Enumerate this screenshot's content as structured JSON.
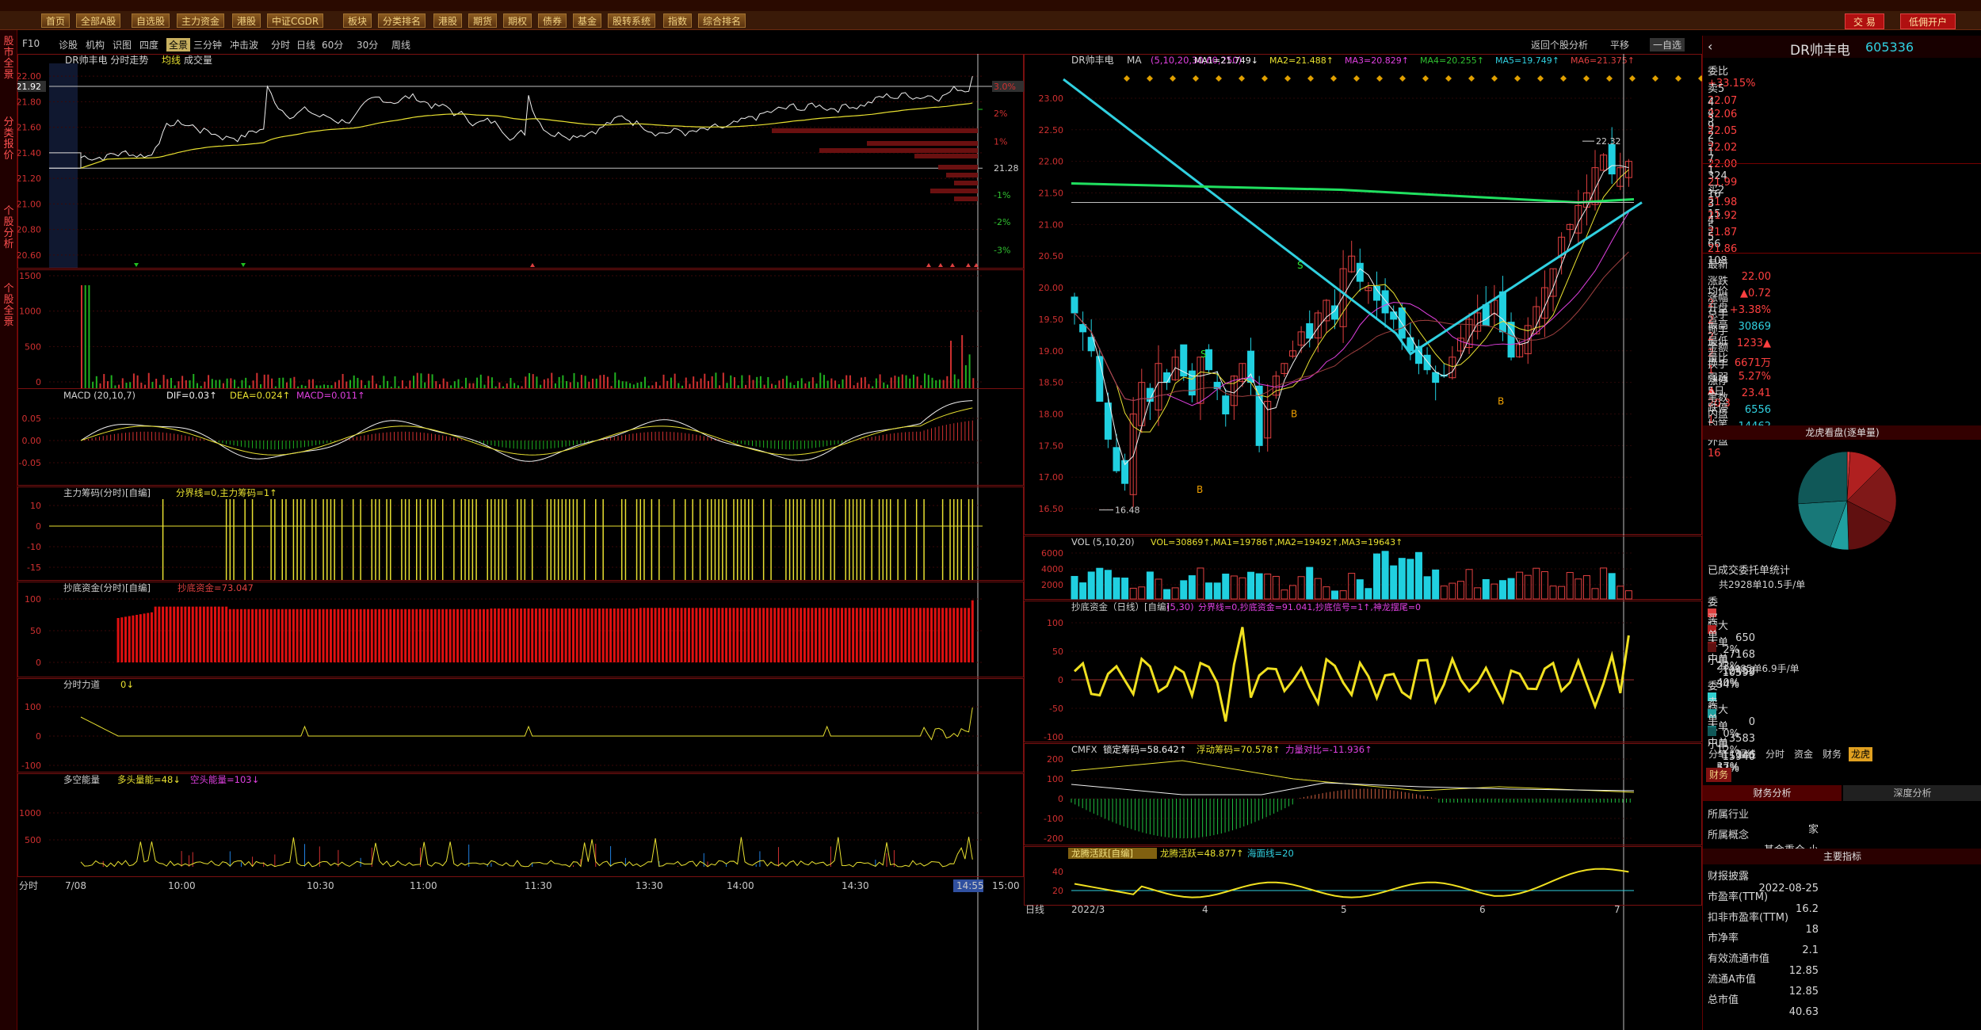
{
  "menubar": {
    "items": [
      "首页",
      "全部A股",
      "自选股",
      "主力资金",
      "港股",
      "中证CGDR",
      "板块",
      "分类排名",
      "港股",
      "期货",
      "期权",
      "债券",
      "基金",
      "股转系统",
      "指数",
      "综合排名"
    ],
    "trade": "交 易",
    "open_account": "低佣开户"
  },
  "leftnav": {
    "items": [
      "股市全景",
      "分类报价",
      "个股分析",
      "个股全景"
    ]
  },
  "subtoolbar": {
    "left": [
      "F10",
      "诊股",
      "机构",
      "识图",
      "四度",
      "全景",
      "三分钟",
      "冲击波"
    ],
    "periods": [
      "分时",
      "日线",
      "60分",
      "30分",
      "周线"
    ],
    "right": [
      "返回个股分析",
      "平移",
      "一自选"
    ]
  },
  "intraday": {
    "title": "DR帅丰电",
    "subtitle": "分时走势",
    "avg_label": "均线",
    "vol_label": "成交量",
    "price_ticks": [
      "22.00",
      "21.80",
      "21.60",
      "21.40",
      "21.20",
      "21.00",
      "20.80",
      "20.60"
    ],
    "current_price": "21.92",
    "pct_ticks": [
      "4%",
      "3.0%",
      "2%",
      "1%",
      "21.28",
      "-1%",
      "-2%",
      "-3%"
    ],
    "vol_ticks": [
      "1500",
      "1000",
      "500",
      "0"
    ],
    "macd_title": "MACD",
    "macd_params": "(20,10,7)",
    "macd_dif": "DIF=0.03↑",
    "macd_dea": "DEA=0.024↑",
    "macd_val": "MACD=0.011↑",
    "macd_ticks": [
      "0.05",
      "0.00",
      "-0.05"
    ],
    "zlcm_title": "主力筹码(分时)[自编]",
    "zlcm_line": "分界线=0,主力筹码=1↑",
    "zlcm_ticks": [
      "10",
      "0",
      "-10",
      "-15"
    ],
    "cdzj_title": "抄底资金(分时)[自编]",
    "cdzj_line": "抄底资金=73.047",
    "cdzj_ticks": [
      "100",
      "50",
      "0"
    ],
    "fsld_title": "分时力道",
    "fsld_val": "0↓",
    "fsld_ticks": [
      "100",
      "0",
      "-100"
    ],
    "dknl_title": "多空能量",
    "dknl_a": "多头量能=48↓",
    "dknl_b": "空头能量=103↓",
    "dknl_ticks": [
      "1000",
      "500"
    ],
    "x_ticks": [
      "7/08",
      "10:00",
      "10:30",
      "11:00",
      "11:30",
      "13:30",
      "14:00",
      "14:30",
      "14:55",
      "15:00"
    ],
    "x_first": "分时"
  },
  "daily": {
    "title": "DR帅丰电",
    "ma_label": "MA",
    "ma_params": "(5,10,20,30,60,250)",
    "ma1": "MA1=21.749↓",
    "ma2": "MA2=21.488↑",
    "ma3": "MA3=20.829↑",
    "ma4": "MA4=20.255↑",
    "ma5": "MA5=19.749↑",
    "ma6": "MA6=21.375↑",
    "price_ticks": [
      "23.00",
      "22.50",
      "22.00",
      "21.50",
      "21.00",
      "20.50",
      "20.00",
      "19.50",
      "19.00",
      "18.50",
      "18.00",
      "17.50",
      "17.00",
      "16.50"
    ],
    "high_label": "22.32",
    "low_label": "16.48",
    "vol_title": "VOL",
    "vol_params": "(5,10,20)",
    "vol_vals": "VOL=30869↑,MA1=19786↑,MA2=19492↑,MA3=19643↑",
    "vol_ticks": [
      "6000",
      "4000",
      "2000"
    ],
    "cdzj_title": "抄底资金（日线）[自编]",
    "cdzj_params": "(5,30)",
    "cdzj_vals": "分界线=0,抄底资金=91.041,抄底信号=1↑,神龙摆尾=0",
    "cdzj_ticks": [
      "100",
      "50",
      "0",
      "-50",
      "-100"
    ],
    "cmfx_title": "CMFX",
    "cmfx_a": "锁定筹码=58.642↑",
    "cmfx_b": "浮动筹码=70.578↑",
    "cmfx_c": "力量对比=-11.936↑",
    "cmfx_ticks": [
      "200",
      "100",
      "0",
      "-100",
      "-200"
    ],
    "lthy_title": "龙腾活跃[自编]",
    "lthy_a": "龙腾活跃=48.877↑",
    "lthy_b": "海面线=20",
    "lthy_ticks": [
      "40",
      "20"
    ],
    "x_ticks": [
      "2022/3",
      "4",
      "5",
      "6",
      "7"
    ],
    "x_first": "日线"
  },
  "quote": {
    "name": "DR帅丰电",
    "code": "605336",
    "weibi_label": "委比",
    "weibi": "+33.15%",
    "weicha": "-",
    "asks": [
      {
        "label": "卖5",
        "price": "22.07",
        "vol": "4"
      },
      {
        "label": "4",
        "price": "22.06",
        "vol": "9"
      },
      {
        "label": "3",
        "price": "22.05",
        "vol": "5"
      },
      {
        "label": "2",
        "price": "22.02",
        "vol": "7"
      },
      {
        "label": "1",
        "price": "22.00",
        "vol": "324"
      }
    ],
    "bids": [
      {
        "label": "1",
        "price": "21.99",
        "vol": "16"
      },
      {
        "label": "2",
        "price": "21.98",
        "vol": "15"
      },
      {
        "label": "3",
        "price": "21.92",
        "vol": "5"
      },
      {
        "label": "4",
        "price": "21.87",
        "vol": "66"
      },
      {
        "label": "5",
        "price": "21.86",
        "vol": "108"
      }
    ],
    "stats": [
      {
        "k": "最新",
        "v": "22.00",
        "k2": "均价",
        "v2": "2"
      },
      {
        "k": "涨跌",
        "v": "▲0.72",
        "k2": "开盘",
        "v2": "2"
      },
      {
        "k": "涨幅",
        "v": "+3.38%",
        "k2": "最高",
        "v2": "2"
      },
      {
        "k": "总手",
        "v": "30869",
        "k2": "最低",
        "v2": "2"
      },
      {
        "k": "现手",
        "v": "1233▲",
        "k2": "量比",
        "v2": "1"
      },
      {
        "k": "金额",
        "v": "6671万",
        "k2": "强弱",
        "v2": "▲"
      },
      {
        "k": "换手",
        "v": "5.27%",
        "k2": "5日",
        "v2": "20.3"
      },
      {
        "k": "涨停",
        "v": "23.41",
        "k2": "跌停",
        "v2": "1"
      },
      {
        "k": "笔数",
        "v": "6556",
        "k2": "均笔",
        "v2": ""
      },
      {
        "k": "内盘",
        "v": "14462",
        "k2": "外盘",
        "v2": "16"
      }
    ],
    "pie_title": "龙虎看盘(逐单量)",
    "order_title": "已成交委托单统计",
    "buy_total": "共2928单10.5手/单",
    "buy_rows": [
      {
        "t": "特大",
        "n": "650",
        "p": "2%",
        "c": "#e04040"
      },
      {
        "t": "大单",
        "n": "7168",
        "p": "23%",
        "c": "#b02020"
      },
      {
        "t": "中单",
        "n": "12452",
        "p": "40%",
        "c": "#801818"
      },
      {
        "t": "小单",
        "n": "10599",
        "p": "34%",
        "c": "#601010"
      }
    ],
    "sell_total": "共4485单6.9手/单",
    "sell_rows": [
      {
        "t": "特大",
        "n": "0",
        "p": "0%",
        "c": "#30d0d0"
      },
      {
        "t": "大单",
        "n": "3583",
        "p": "12%",
        "c": "#20a0a0"
      },
      {
        "t": "中单",
        "n": "11346",
        "p": "37%",
        "c": "#187878"
      },
      {
        "t": "小单",
        "n": "15940",
        "p": "52%",
        "c": "#105858"
      }
    ],
    "side_buy": "委买单",
    "side_sell": "委卖单",
    "tabs": [
      "分笔",
      "短线",
      "分时",
      "资金",
      "财务",
      "龙虎"
    ],
    "fin_tab": "财务",
    "fin_sub": [
      "财务分析",
      "深度分析"
    ],
    "industry_k": "所属行业",
    "industry_v": "家",
    "concept_k": "所属概念",
    "concept_v": "基金重仓,小",
    "main_index": "主要指标",
    "fin_rows": [
      {
        "k": "财报披露",
        "v": "2022-08-25"
      },
      {
        "k": "市盈率(TTM)",
        "v": "16.2"
      },
      {
        "k": "扣非市盈率(TTM)",
        "v": "18"
      },
      {
        "k": "市净率",
        "v": "2.1"
      },
      {
        "k": "有效流通市值",
        "v": "12.85"
      },
      {
        "k": "流通A市值",
        "v": "12.85"
      },
      {
        "k": "总市值",
        "v": "40.63"
      }
    ]
  }
}
